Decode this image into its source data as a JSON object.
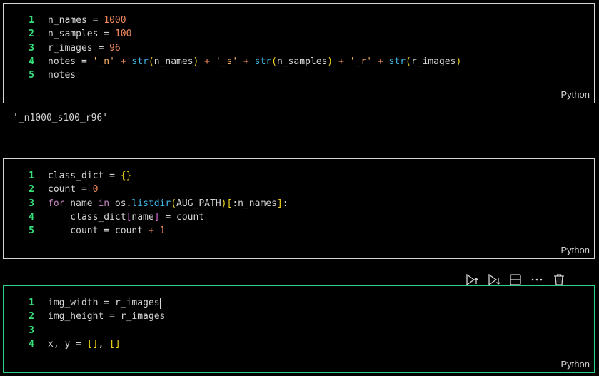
{
  "cells": [
    {
      "language": "Python",
      "lines": [
        {
          "n": "1",
          "tokens": [
            {
              "t": "n_names ",
              "c": "fg"
            },
            {
              "t": "=",
              "c": "fg"
            },
            {
              "t": " ",
              "c": "fg"
            },
            {
              "t": "1000",
              "c": "num"
            }
          ]
        },
        {
          "n": "2",
          "tokens": [
            {
              "t": "n_samples ",
              "c": "fg"
            },
            {
              "t": "=",
              "c": "fg"
            },
            {
              "t": " ",
              "c": "fg"
            },
            {
              "t": "100",
              "c": "num"
            }
          ]
        },
        {
          "n": "3",
          "tokens": [
            {
              "t": "r_images ",
              "c": "fg"
            },
            {
              "t": "=",
              "c": "fg"
            },
            {
              "t": " ",
              "c": "fg"
            },
            {
              "t": "96",
              "c": "num"
            }
          ]
        },
        {
          "n": "4",
          "tokens": [
            {
              "t": "notes ",
              "c": "fg"
            },
            {
              "t": "=",
              "c": "fg"
            },
            {
              "t": " ",
              "c": "fg"
            },
            {
              "t": "'_n'",
              "c": "str"
            },
            {
              "t": " + ",
              "c": "op"
            },
            {
              "t": "str",
              "c": "fn"
            },
            {
              "t": "(",
              "c": "paren"
            },
            {
              "t": "n_names",
              "c": "fg"
            },
            {
              "t": ")",
              "c": "paren"
            },
            {
              "t": " + ",
              "c": "op"
            },
            {
              "t": "'_s'",
              "c": "str"
            },
            {
              "t": " + ",
              "c": "op"
            },
            {
              "t": "str",
              "c": "fn"
            },
            {
              "t": "(",
              "c": "paren"
            },
            {
              "t": "n_samples",
              "c": "fg"
            },
            {
              "t": ")",
              "c": "paren"
            },
            {
              "t": " + ",
              "c": "op"
            },
            {
              "t": "'_r'",
              "c": "str"
            },
            {
              "t": " + ",
              "c": "op"
            },
            {
              "t": "str",
              "c": "fn"
            },
            {
              "t": "(",
              "c": "paren"
            },
            {
              "t": "r_images",
              "c": "fg"
            },
            {
              "t": ")",
              "c": "paren"
            }
          ]
        },
        {
          "n": "5",
          "tokens": [
            {
              "t": "notes",
              "c": "fg"
            }
          ]
        }
      ]
    },
    {
      "language": "Python",
      "lines": [
        {
          "n": "1",
          "tokens": [
            {
              "t": "class_dict ",
              "c": "fg"
            },
            {
              "t": "=",
              "c": "fg"
            },
            {
              "t": " ",
              "c": "fg"
            },
            {
              "t": "{}",
              "c": "paren"
            }
          ]
        },
        {
          "n": "2",
          "tokens": [
            {
              "t": "count ",
              "c": "fg"
            },
            {
              "t": "=",
              "c": "fg"
            },
            {
              "t": " ",
              "c": "fg"
            },
            {
              "t": "0",
              "c": "num"
            }
          ]
        },
        {
          "n": "3",
          "tokens": [
            {
              "t": "for",
              "c": "kw"
            },
            {
              "t": " name ",
              "c": "fg"
            },
            {
              "t": "in",
              "c": "kw"
            },
            {
              "t": " os.",
              "c": "fg"
            },
            {
              "t": "listdir",
              "c": "fn"
            },
            {
              "t": "(",
              "c": "paren"
            },
            {
              "t": "AUG_PATH",
              "c": "fg"
            },
            {
              "t": ")",
              "c": "paren"
            },
            {
              "t": "[",
              "c": "paren"
            },
            {
              "t": ":n_names",
              "c": "fg"
            },
            {
              "t": "]",
              "c": "paren"
            },
            {
              "t": ":",
              "c": "fg"
            }
          ]
        },
        {
          "n": "4",
          "tokens": [
            {
              "t": "    class_dict",
              "c": "fg"
            },
            {
              "t": "[",
              "c": "bracket2"
            },
            {
              "t": "name",
              "c": "fg"
            },
            {
              "t": "]",
              "c": "bracket2"
            },
            {
              "t": " = count",
              "c": "fg"
            }
          ]
        },
        {
          "n": "5",
          "tokens": [
            {
              "t": "    count ",
              "c": "fg"
            },
            {
              "t": "=",
              "c": "fg"
            },
            {
              "t": " count ",
              "c": "fg"
            },
            {
              "t": "+",
              "c": "op"
            },
            {
              "t": " ",
              "c": "fg"
            },
            {
              "t": "1",
              "c": "num"
            }
          ]
        }
      ]
    },
    {
      "language": "Python",
      "lines": [
        {
          "n": "1",
          "tokens": [
            {
              "t": "img_width ",
              "c": "fg"
            },
            {
              "t": "=",
              "c": "fg"
            },
            {
              "t": " r_images",
              "c": "fg"
            }
          ]
        },
        {
          "n": "2",
          "tokens": [
            {
              "t": "img_height ",
              "c": "fg"
            },
            {
              "t": "=",
              "c": "fg"
            },
            {
              "t": " r_images",
              "c": "fg"
            }
          ]
        },
        {
          "n": "3",
          "tokens": []
        },
        {
          "n": "4",
          "tokens": [
            {
              "t": "x, y ",
              "c": "fg"
            },
            {
              "t": "=",
              "c": "fg"
            },
            {
              "t": " ",
              "c": "fg"
            },
            {
              "t": "[]",
              "c": "paren"
            },
            {
              "t": ", ",
              "c": "fg"
            },
            {
              "t": "[]",
              "c": "paren"
            }
          ]
        }
      ]
    }
  ],
  "output": {
    "text": "'_n1000_s100_r96'"
  },
  "toolbar": {
    "buttons": [
      {
        "name": "execute-above-cells-icon"
      },
      {
        "name": "execute-cell-and-below-icon"
      },
      {
        "name": "split-cell-icon"
      },
      {
        "name": "more-actions-icon"
      },
      {
        "name": "delete-cell-icon"
      }
    ]
  },
  "colors": {
    "active_border": "#2fd08a",
    "line_number": "#35e07b",
    "number": "#f08a5d",
    "string": "#f8b26a",
    "function": "#3fb7e6",
    "bracket": "#f2d41b",
    "keyword": "#c586c0"
  }
}
